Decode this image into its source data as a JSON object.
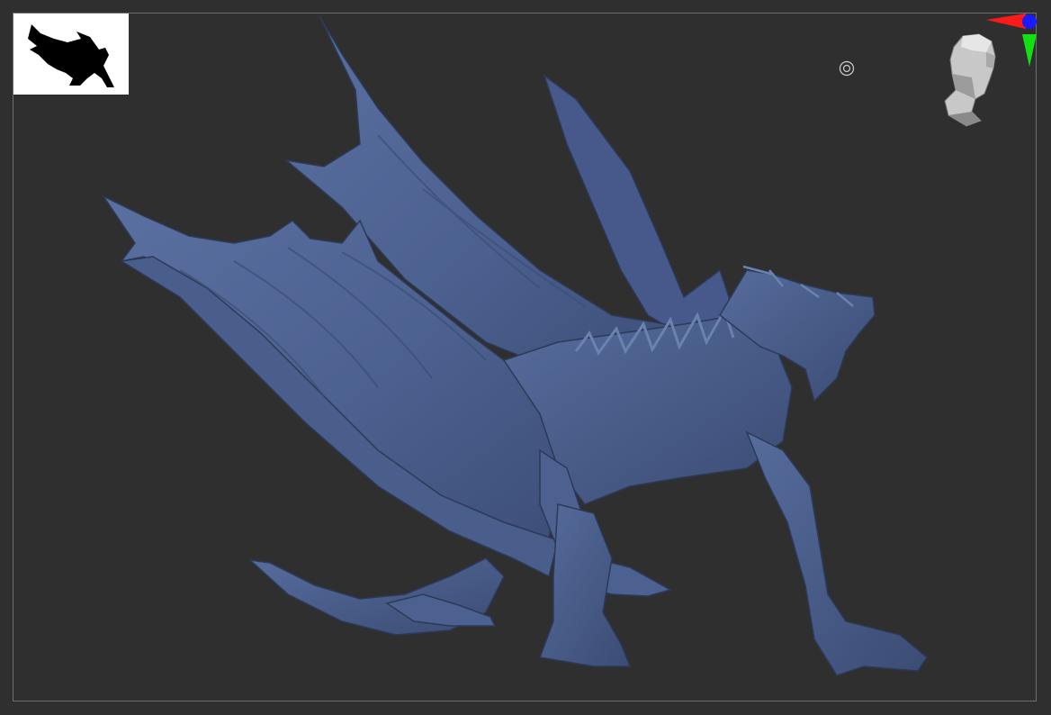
{
  "app": {
    "title": "",
    "canvas": {
      "background_color": "#2f2f2f",
      "frame_color": "#6e6e6e"
    }
  },
  "navigator": {
    "icon": "dragon-silhouette-icon",
    "background_color": "#ffffff",
    "silhouette_color": "#000000"
  },
  "model": {
    "icon": "dragon-sculpt",
    "material_color": "#4f6591",
    "shadow_color": "#33425f",
    "highlight_color": "#6a82b0"
  },
  "orientation_gizmo": {
    "icon": "head-gizmo-icon",
    "axis_x_color": "#ff1a1a",
    "axis_y_color": "#12e012",
    "axis_z_color": "#1a1aff"
  },
  "pivot": {
    "icon": "pivot-circle-icon"
  }
}
